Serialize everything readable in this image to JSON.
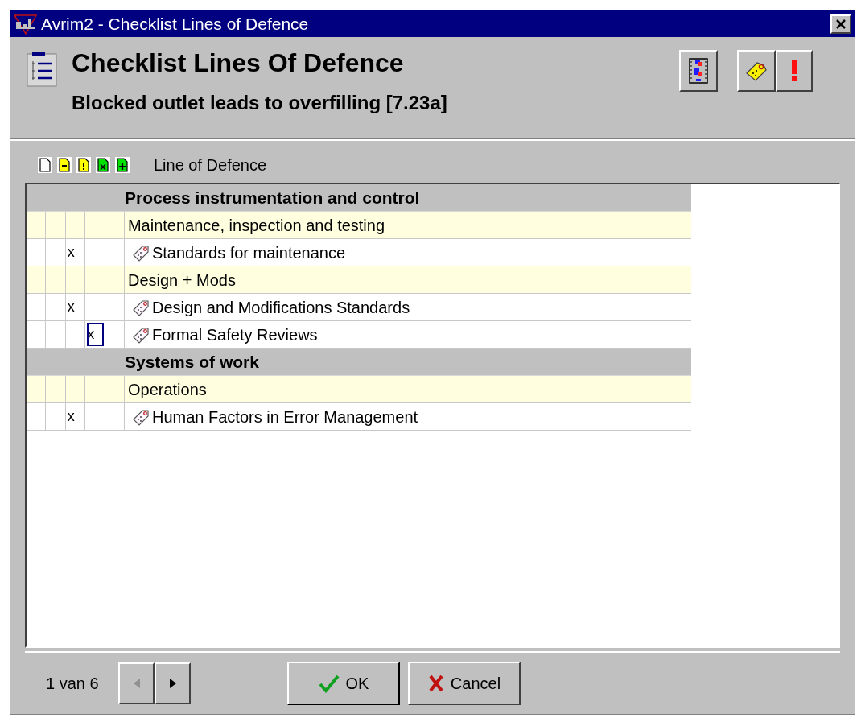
{
  "window": {
    "title": "Avrim2 - Checklist Lines of Defence"
  },
  "header": {
    "title": "Checklist Lines Of Defence",
    "subtitle": "Blocked outlet leads to overfilling [7.23a]"
  },
  "grid": {
    "heading": "Line of Defence",
    "rows": [
      {
        "kind": "group",
        "label": "Process instrumentation and control"
      },
      {
        "kind": "subgroup",
        "label": "Maintenance, inspection and testing"
      },
      {
        "kind": "item",
        "label": "Standards for maintenance",
        "mark": "x",
        "cells": [
          {
            "checked": false,
            "focused": false
          },
          {
            "checked": false,
            "focused": false
          },
          {
            "checked": true,
            "focused": false
          },
          {
            "checked": false,
            "focused": false
          },
          {
            "checked": false,
            "focused": false
          }
        ]
      },
      {
        "kind": "subgroup",
        "label": "Design + Mods"
      },
      {
        "kind": "item",
        "label": "Design and Modifications Standards",
        "mark": "x",
        "cells": [
          {
            "checked": false,
            "focused": false
          },
          {
            "checked": false,
            "focused": false
          },
          {
            "checked": true,
            "focused": false
          },
          {
            "checked": false,
            "focused": false
          },
          {
            "checked": false,
            "focused": false
          }
        ]
      },
      {
        "kind": "item",
        "label": "Formal Safety Reviews",
        "mark": "x",
        "cells": [
          {
            "checked": false,
            "focused": false
          },
          {
            "checked": false,
            "focused": false
          },
          {
            "checked": false,
            "focused": false
          },
          {
            "checked": true,
            "focused": true
          },
          {
            "checked": false,
            "focused": false
          }
        ]
      },
      {
        "kind": "group",
        "label": "Systems of work"
      },
      {
        "kind": "subgroup",
        "label": "Operations"
      },
      {
        "kind": "item",
        "label": "Human Factors in Error Management",
        "mark": "x",
        "cells": [
          {
            "checked": false,
            "focused": false
          },
          {
            "checked": false,
            "focused": false
          },
          {
            "checked": true,
            "focused": false
          },
          {
            "checked": false,
            "focused": false
          },
          {
            "checked": false,
            "focused": false
          }
        ]
      }
    ]
  },
  "footer": {
    "page": "1 van 6",
    "prev": {
      "disabled": true
    },
    "next": {
      "disabled": false
    },
    "buttons": [
      {
        "kind": "ok",
        "label": "OK"
      },
      {
        "kind": "cancel",
        "label": "Cancel"
      }
    ]
  }
}
